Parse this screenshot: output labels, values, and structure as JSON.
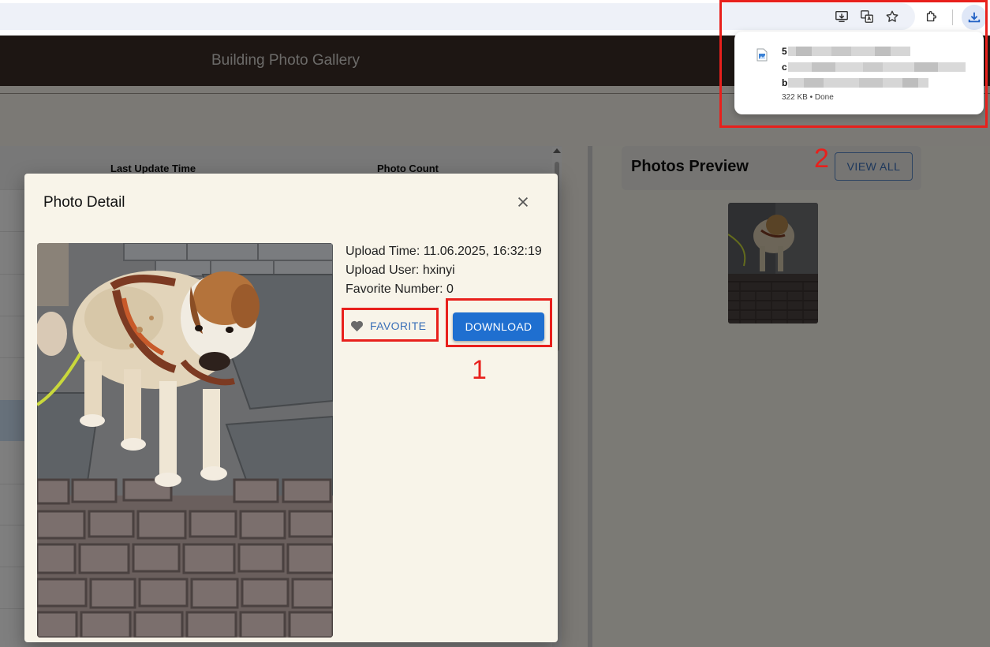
{
  "app": {
    "title": "Building Photo Gallery"
  },
  "toolbar": {
    "icons": [
      "install-app-icon",
      "translate-icon",
      "bookmark-star-icon",
      "extensions-icon",
      "download-icon"
    ]
  },
  "table": {
    "headers": [
      "Last Update Time",
      "Photo Count"
    ]
  },
  "preview": {
    "title": "Photos Preview",
    "view_all_label": "VIEW ALL"
  },
  "dialog": {
    "title": "Photo Detail",
    "upload_time": "Upload Time: 11.06.2025, 16:32:19",
    "upload_user": "Upload User: hxinyi",
    "favorite_number": "Favorite Number: 0",
    "favorite_label": "FAVORITE",
    "download_label": "DOWNLOAD"
  },
  "downloads": {
    "name_line_1": "5",
    "name_line_2": "c",
    "name_line_3": "b",
    "status": "322 KB • Done"
  },
  "annotations": {
    "label_1": "1",
    "label_2": "2",
    "color": "#e8201c"
  },
  "colors": {
    "header_bg": "#3a2c27",
    "accent": "#1f6fd0",
    "dialog_bg": "#f8f4e9"
  }
}
